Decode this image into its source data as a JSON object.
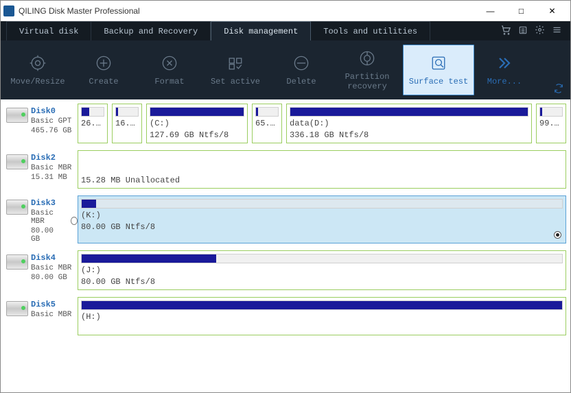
{
  "window": {
    "title": "QILING Disk Master Professional"
  },
  "tabs": [
    {
      "label": "Virtual disk"
    },
    {
      "label": "Backup and Recovery"
    },
    {
      "label": "Disk management",
      "active": true
    },
    {
      "label": "Tools and utilities"
    }
  ],
  "toolbar": {
    "move_resize": "Move/Resize",
    "create": "Create",
    "format": "Format",
    "set_active": "Set active",
    "delete": "Delete",
    "partition_recovery": "Partition\nrecovery",
    "surface_test": "Surface test",
    "more": "More..."
  },
  "disks": {
    "d0": {
      "name": "Disk0",
      "type": "Basic GPT",
      "size": "465.76 GB"
    },
    "d2": {
      "name": "Disk2",
      "type": "Basic MBR",
      "size": "15.31 MB"
    },
    "d3": {
      "name": "Disk3",
      "type": "Basic MBR",
      "size": "80.00 GB"
    },
    "d4": {
      "name": "Disk4",
      "type": "Basic MBR",
      "size": "80.00 GB"
    },
    "d5": {
      "name": "Disk5",
      "type": "Basic MBR",
      "size": ""
    }
  },
  "parts": {
    "d0p0": {
      "short": "26..."
    },
    "d0p1": {
      "short": "16..."
    },
    "d0p2": {
      "label": "(C:)",
      "desc": "127.69 GB Ntfs/8"
    },
    "d0p3": {
      "short": "65..."
    },
    "d0p4": {
      "label": "data(D:)",
      "desc": "336.18 GB Ntfs/8"
    },
    "d0p5": {
      "short": "99..."
    },
    "d2p0": {
      "desc": "15.28 MB Unallocated"
    },
    "d3p0": {
      "label": "(K:)",
      "desc": "80.00 GB Ntfs/8"
    },
    "d4p0": {
      "label": "(J:)",
      "desc": "80.00 GB Ntfs/8"
    },
    "d5p0": {
      "label": "(H:)"
    }
  }
}
